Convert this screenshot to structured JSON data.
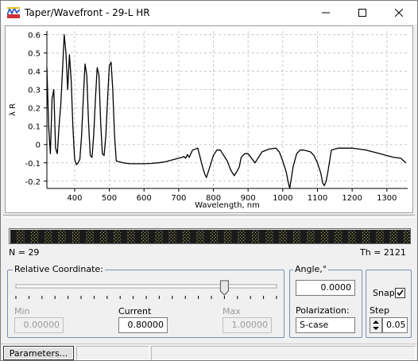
{
  "window": {
    "title": "Taper/Wavefront - 29-L HR"
  },
  "chart_data": {
    "type": "line",
    "xlabel": "Wavelength, nm",
    "ylabel": "λ R",
    "xlim": [
      320,
      1360
    ],
    "ylim": [
      -0.24,
      0.62
    ],
    "xticks": [
      400,
      500,
      600,
      700,
      800,
      900,
      1000,
      1100,
      1200,
      1300
    ],
    "yticks": [
      -0.2,
      -0.1,
      0,
      0.1,
      0.2,
      0.3,
      0.4,
      0.5,
      0.6
    ],
    "xtick_labels": [
      "400",
      "500",
      "600",
      "700",
      "800",
      "900",
      "1000",
      "1100",
      "1200",
      "1300"
    ],
    "ytick_labels": [
      "-0.2",
      "-0.1",
      "0",
      "0.1",
      "0.2",
      "0.3",
      "0.4",
      "0.5",
      "0.6"
    ],
    "grid": true,
    "series": [
      {
        "x": [
          320,
          325,
          330,
          335,
          340,
          345,
          350,
          355,
          360,
          365,
          370,
          375,
          380,
          385,
          390,
          395,
          400,
          405,
          410,
          415,
          420,
          425,
          430,
          435,
          440,
          445,
          450,
          455,
          460,
          465,
          470,
          475,
          480,
          485,
          490,
          495,
          500,
          505,
          510,
          515,
          520,
          540,
          560,
          580,
          600,
          620,
          640,
          660,
          680,
          700,
          710,
          715,
          720,
          725,
          730,
          740,
          755,
          770,
          775,
          780,
          790,
          800,
          810,
          820,
          830,
          840,
          850,
          860,
          870,
          875,
          880,
          890,
          900,
          920,
          940,
          960,
          980,
          990,
          1000,
          1010,
          1015,
          1020,
          1025,
          1030,
          1040,
          1050,
          1060,
          1070,
          1080,
          1090,
          1100,
          1110,
          1115,
          1120,
          1125,
          1130,
          1140,
          1160,
          1180,
          1200,
          1220,
          1240,
          1260,
          1280,
          1300,
          1320,
          1340,
          1355
        ],
        "y": [
          0.42,
          0.1,
          -0.05,
          0.25,
          0.3,
          -0.02,
          -0.05,
          0.1,
          0.22,
          0.4,
          0.6,
          0.5,
          0.3,
          0.49,
          0.35,
          0.1,
          -0.08,
          -0.11,
          -0.1,
          -0.08,
          0.05,
          0.25,
          0.44,
          0.38,
          0.12,
          -0.06,
          -0.07,
          0.05,
          0.25,
          0.42,
          0.38,
          0.12,
          -0.05,
          -0.06,
          0.05,
          0.25,
          0.43,
          0.45,
          0.3,
          0.05,
          -0.09,
          -0.1,
          -0.105,
          -0.105,
          -0.105,
          -0.103,
          -0.1,
          -0.095,
          -0.085,
          -0.075,
          -0.07,
          -0.065,
          -0.075,
          -0.055,
          -0.07,
          -0.03,
          -0.02,
          -0.13,
          -0.16,
          -0.18,
          -0.12,
          -0.06,
          -0.03,
          -0.03,
          -0.06,
          -0.09,
          -0.14,
          -0.17,
          -0.14,
          -0.12,
          -0.07,
          -0.05,
          -0.05,
          -0.1,
          -0.04,
          -0.025,
          -0.02,
          -0.04,
          -0.09,
          -0.15,
          -0.2,
          -0.24,
          -0.18,
          -0.12,
          -0.05,
          -0.03,
          -0.03,
          -0.035,
          -0.04,
          -0.06,
          -0.1,
          -0.16,
          -0.21,
          -0.225,
          -0.2,
          -0.15,
          -0.03,
          -0.02,
          -0.02,
          -0.02,
          -0.025,
          -0.03,
          -0.04,
          -0.05,
          -0.06,
          -0.07,
          -0.075,
          -0.1
        ]
      }
    ]
  },
  "strip": {
    "n_label": "N = 29",
    "th_label": "Th = 2121",
    "count": 29
  },
  "relative_coordinate": {
    "title": "Relative Coordinate:",
    "min_label": "Min",
    "current_label": "Current",
    "max_label": "Max",
    "min_value": "0.00000",
    "current_value": "0.80000",
    "max_value": "1.00000",
    "slider_fraction": 0.8
  },
  "angle": {
    "title": "Angle,°",
    "value": "0.0000",
    "polarization_label": "Polarization:",
    "polarization_value": "S-case"
  },
  "snap": {
    "label": "Snap",
    "checked": true,
    "step_label": "Step",
    "step_value": "0.05"
  },
  "statusbar": {
    "parameters_button": "Parameters..."
  },
  "colors": {
    "strip_dark": "#1a1a1a",
    "strip_light": "#c8c860",
    "group_border": "#7a8fb4"
  }
}
